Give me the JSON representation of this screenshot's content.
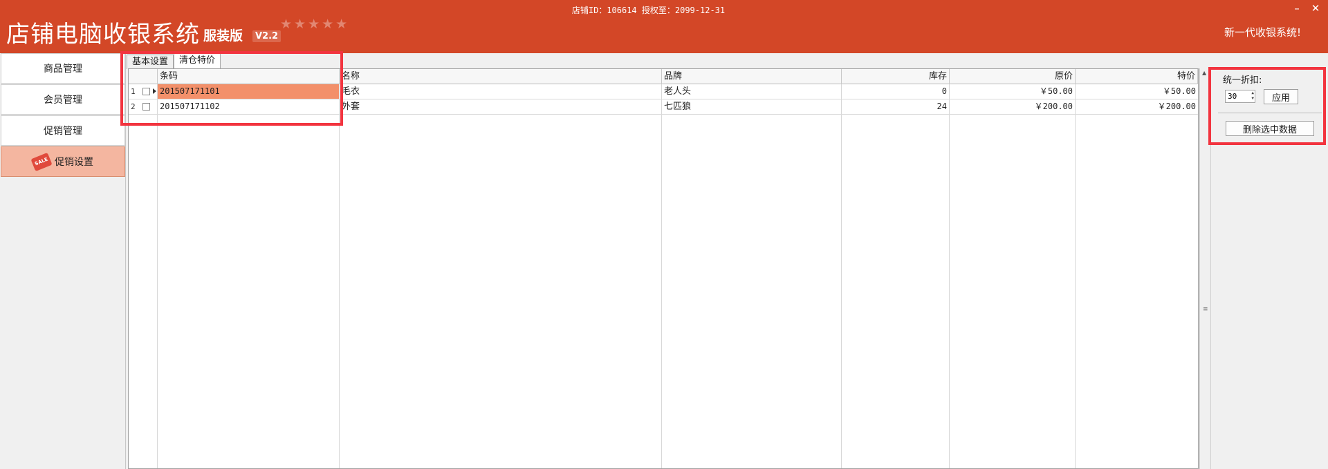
{
  "header": {
    "top_info": "店铺ID：106614 授权至：2099-12-31",
    "app_title": "店铺电脑收银系统",
    "edition": "服装版",
    "version": "V2.2",
    "slogan": "新一代收银系统!",
    "minimize_label": "–",
    "close_label": "✕"
  },
  "sidebar": {
    "items": [
      {
        "label": "商品管理"
      },
      {
        "label": "会员管理"
      },
      {
        "label": "促销管理"
      },
      {
        "label": "促销设置",
        "active": true,
        "icon": "sale-tag-icon",
        "icon_text": "SALE"
      }
    ]
  },
  "tabs": [
    {
      "label": "基本设置"
    },
    {
      "label": "清仓特价",
      "active": true
    }
  ],
  "table": {
    "columns": [
      "条码",
      "名称",
      "品牌",
      "库存",
      "原价",
      "特价"
    ],
    "rows": [
      {
        "num": "1",
        "barcode": "201507171101",
        "name": "毛衣",
        "brand": "老人头",
        "stock": "0",
        "original_price": "￥50.00",
        "special_price": "￥50.00",
        "selected": true
      },
      {
        "num": "2",
        "barcode": "201507171102",
        "name": "外套",
        "brand": "七匹狼",
        "stock": "24",
        "original_price": "￥200.00",
        "special_price": "￥200.00",
        "selected": false
      }
    ]
  },
  "panel": {
    "discount_label": "统一折扣:",
    "discount_value": "30",
    "apply_label": "应用",
    "delete_label": "删除选中数据"
  },
  "colors": {
    "title_bar": "#d34727",
    "active_nav": "#f4b6a0",
    "selected_cell": "#f3906a",
    "highlight_box": "#f2343f"
  }
}
